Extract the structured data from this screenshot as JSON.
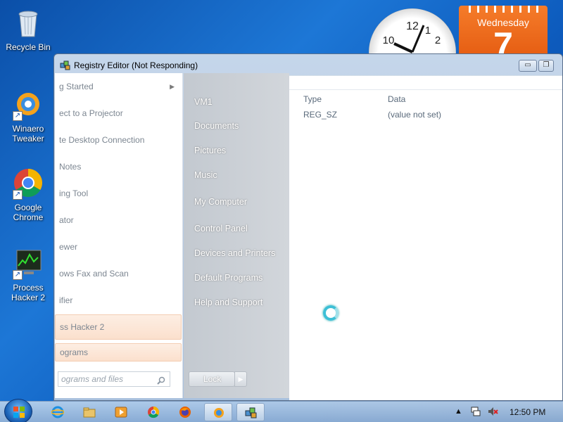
{
  "desktop": {
    "icons": [
      {
        "label": "Recycle Bin"
      },
      {
        "label": "Winaero Tweaker"
      },
      {
        "label": "Google Chrome"
      },
      {
        "label": "Process Hacker 2"
      }
    ],
    "clock": {
      "n12": "12",
      "n1": "1",
      "n2": "2",
      "n10": "10"
    },
    "calendar": {
      "day_name": "Wednesday",
      "day_number": "7"
    }
  },
  "window": {
    "title": "Registry Editor (Not Responding)",
    "minimize": "▭",
    "restore": "❐",
    "columns": {
      "type": "Type",
      "data": "Data"
    },
    "row": {
      "type": "REG_SZ",
      "data": "(value not set)"
    }
  },
  "start_menu": {
    "programs": [
      {
        "label": "g Started",
        "has_arrow": true
      },
      {
        "label": "ect to a Projector"
      },
      {
        "label": "te Desktop Connection"
      },
      {
        "label": "Notes"
      },
      {
        "label": "ing Tool"
      },
      {
        "label": "ator"
      },
      {
        "label": "ewer"
      },
      {
        "label": "ows Fax and Scan"
      },
      {
        "label": "ifier"
      },
      {
        "label": "ss Hacker 2"
      },
      {
        "label": "ograms"
      }
    ],
    "search_placeholder": "ograms and files",
    "places": [
      {
        "label": "VM1"
      },
      {
        "label": "Documents"
      },
      {
        "label": "Pictures"
      },
      {
        "label": "Music"
      },
      {
        "label": "My Computer"
      },
      {
        "label": "Control Panel"
      },
      {
        "label": "Devices and Printers"
      },
      {
        "label": "Default Programs"
      },
      {
        "label": "Help and Support"
      }
    ],
    "lock_label": "Lock",
    "arrow_glyph": "▶"
  },
  "taskbar": {
    "time": "12:50 PM",
    "tray_arrow": "▲"
  },
  "colors": {
    "start_hover": "#fbe0cd",
    "desktop_blue": "#1d77d6",
    "calendar_orange": "#e45a10"
  }
}
